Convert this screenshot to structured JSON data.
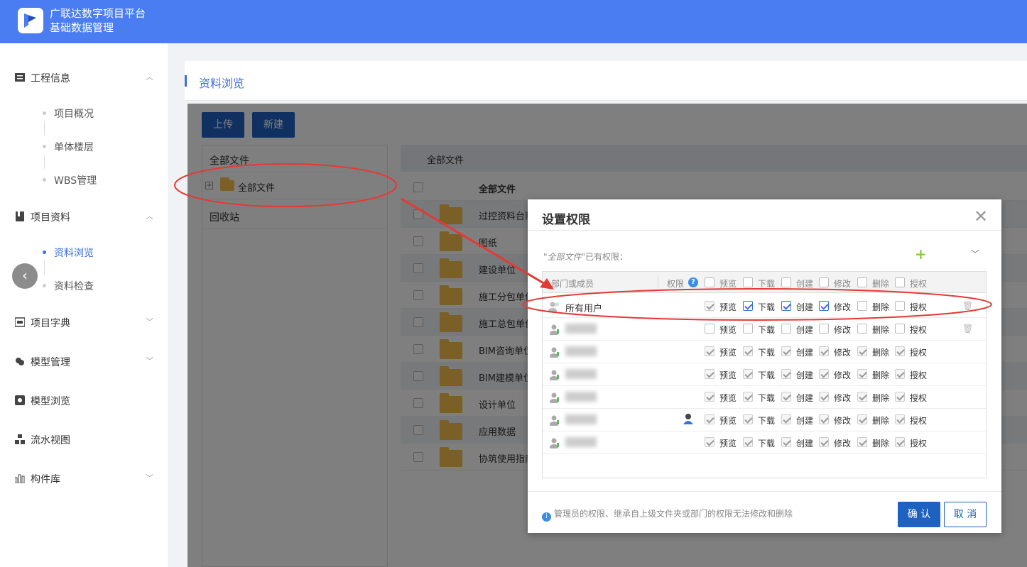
{
  "app": {
    "title_line1": "广联达数字项目平台",
    "title_line2": "基础数据管理"
  },
  "sidebar": {
    "groups": [
      {
        "label": "工程信息",
        "expanded": true,
        "items": [
          "项目概况",
          "单体楼层",
          "WBS管理"
        ]
      },
      {
        "label": "项目资料",
        "expanded": true,
        "items": [
          "资料浏览",
          "资料检查"
        ],
        "active_item": "资料浏览"
      },
      {
        "label": "项目字典",
        "expanded": false
      },
      {
        "label": "模型管理",
        "expanded": false
      },
      {
        "label": "模型浏览"
      },
      {
        "label": "流水视图"
      },
      {
        "label": "构件库",
        "expanded": false
      }
    ],
    "collapse_icon": "chevron-left-icon"
  },
  "page": {
    "title": "资料浏览"
  },
  "toolbar": {
    "upload_label": "上传",
    "new_label": "新建"
  },
  "tree": {
    "header": "全部文件",
    "root_label": "全部文件",
    "recycle_label": "回收站"
  },
  "file_list": {
    "breadcrumb": "全部文件",
    "header_name": "全部文件",
    "rows": [
      "过控资料台账",
      "图纸",
      "建设单位",
      "施工分包单位",
      "施工总包单位",
      "BIM咨询单位",
      "BIM建模单位",
      "设计单位",
      "应用数据",
      "协筑使用指南"
    ]
  },
  "dialog": {
    "title": "设置权限",
    "note_prefix": "\"全部文件\"",
    "note_suffix": "已有权限：",
    "col_member": "部门或成员",
    "col_perm": "权限",
    "perm_labels": [
      "预览",
      "下载",
      "创建",
      "修改",
      "删除",
      "授权"
    ],
    "rows": [
      {
        "name": "所有用户",
        "perms": [
          "gray",
          "on",
          "on",
          "on",
          "off",
          "off"
        ],
        "deletable": true
      },
      {
        "name": "",
        "blurred": true,
        "perms": [
          "off",
          "off",
          "off",
          "off",
          "off",
          "off"
        ],
        "deletable": true
      },
      {
        "name": "",
        "blurred": true,
        "perms": [
          "gray",
          "gray",
          "gray",
          "gray",
          "gray",
          "gray"
        ]
      },
      {
        "name": "",
        "blurred": true,
        "perms": [
          "gray",
          "gray",
          "gray",
          "gray",
          "gray",
          "gray"
        ]
      },
      {
        "name": "",
        "blurred": true,
        "perms": [
          "gray",
          "gray",
          "gray",
          "gray",
          "gray",
          "gray"
        ]
      },
      {
        "name": "",
        "blurred": true,
        "perms": [
          "gray",
          "gray",
          "gray",
          "gray",
          "gray",
          "gray"
        ],
        "admin": true
      },
      {
        "name": "",
        "blurred": true,
        "perms": [
          "gray",
          "gray",
          "gray",
          "gray",
          "gray",
          "gray"
        ]
      }
    ],
    "footer_note": "管理员的权限、继承自上级文件夹或部门的权限无法修改和删除",
    "ok_label": "确 认",
    "cancel_label": "取 消"
  },
  "colors": {
    "brand": "#4a7cf2",
    "primary": "#1f61c0",
    "accent_green": "#8dc63f",
    "annotation_red": "#e53935"
  }
}
